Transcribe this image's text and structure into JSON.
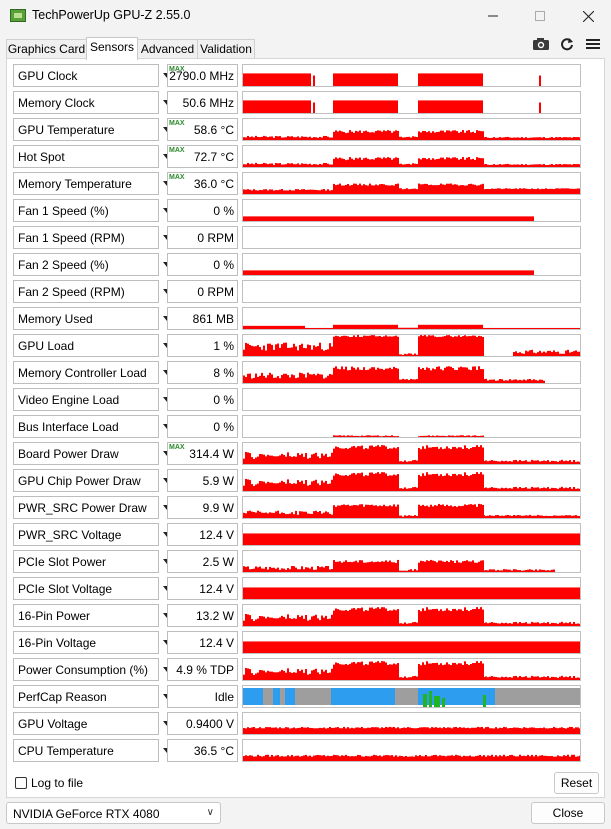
{
  "window": {
    "title": "TechPowerUp GPU-Z 2.55.0",
    "minimize_icon": "minimize-icon",
    "maximize_icon": "maximize-icon",
    "close_icon": "close-icon"
  },
  "tabs": [
    {
      "label": "Graphics Card",
      "active": false
    },
    {
      "label": "Sensors",
      "active": true
    },
    {
      "label": "Advanced",
      "active": false
    },
    {
      "label": "Validation",
      "active": false
    }
  ],
  "toolbar": {
    "camera_icon": "camera-icon",
    "refresh_icon": "refresh-icon",
    "menu_icon": "menu-icon"
  },
  "colors": {
    "graph": "#ff0000",
    "perfcap_gray": "#9e9e9e",
    "perfcap_blue": "#2d9df0",
    "perfcap_green": "#22b322"
  },
  "sensors": [
    {
      "name": "GPU Clock",
      "value": "2790.0 MHz",
      "max": true,
      "graph": "clock"
    },
    {
      "name": "Memory Clock",
      "value": "50.6 MHz",
      "max": false,
      "graph": "clock"
    },
    {
      "name": "GPU Temperature",
      "value": "58.6 °C",
      "max": true,
      "graph": "temp"
    },
    {
      "name": "Hot Spot",
      "value": "72.7 °C",
      "max": true,
      "graph": "temp"
    },
    {
      "name": "Memory Temperature",
      "value": "36.0 °C",
      "max": true,
      "graph": "memtemp"
    },
    {
      "name": "Fan 1 Speed (%)",
      "value": "0 %",
      "max": false,
      "graph": "fan"
    },
    {
      "name": "Fan 1 Speed (RPM)",
      "value": "0 RPM",
      "max": false,
      "graph": "none"
    },
    {
      "name": "Fan 2 Speed (%)",
      "value": "0 %",
      "max": false,
      "graph": "fan"
    },
    {
      "name": "Fan 2 Speed (RPM)",
      "value": "0 RPM",
      "max": false,
      "graph": "none"
    },
    {
      "name": "Memory Used",
      "value": "861 MB",
      "max": false,
      "graph": "memused"
    },
    {
      "name": "GPU Load",
      "value": "1 %",
      "max": false,
      "graph": "load"
    },
    {
      "name": "Memory Controller Load",
      "value": "8 %",
      "max": false,
      "graph": "memload"
    },
    {
      "name": "Video Engine Load",
      "value": "0 %",
      "max": false,
      "graph": "none"
    },
    {
      "name": "Bus Interface Load",
      "value": "0 %",
      "max": false,
      "graph": "bus"
    },
    {
      "name": "Board Power Draw",
      "value": "314.4 W",
      "max": true,
      "graph": "power"
    },
    {
      "name": "GPU Chip Power Draw",
      "value": "5.9 W",
      "max": false,
      "graph": "power"
    },
    {
      "name": "PWR_SRC Power Draw",
      "value": "9.9 W",
      "max": false,
      "graph": "powersrc"
    },
    {
      "name": "PWR_SRC Voltage",
      "value": "12.4 V",
      "max": false,
      "graph": "voltage"
    },
    {
      "name": "PCIe Slot Power",
      "value": "2.5 W",
      "max": false,
      "graph": "pcie"
    },
    {
      "name": "PCIe Slot Voltage",
      "value": "12.4 V",
      "max": false,
      "graph": "voltage"
    },
    {
      "name": "16-Pin Power",
      "value": "13.2 W",
      "max": false,
      "graph": "power"
    },
    {
      "name": "16-Pin Voltage",
      "value": "12.4 V",
      "max": false,
      "graph": "voltage"
    },
    {
      "name": "Power Consumption (%)",
      "value": "4.9 % TDP",
      "max": false,
      "graph": "power"
    },
    {
      "name": "PerfCap Reason",
      "value": "Idle",
      "max": false,
      "graph": "perfcap"
    },
    {
      "name": "GPU Voltage",
      "value": "0.9400 V",
      "max": false,
      "graph": "gpuvolt"
    },
    {
      "name": "CPU Temperature",
      "value": "36.5 °C",
      "max": false,
      "graph": "cputemp"
    }
  ],
  "max_badge": "MAX",
  "footer": {
    "log_label": "Log to file",
    "log_checked": false,
    "reset_label": "Reset",
    "gpu_selected": "NVIDIA GeForce RTX 4080",
    "close_label": "Close"
  }
}
